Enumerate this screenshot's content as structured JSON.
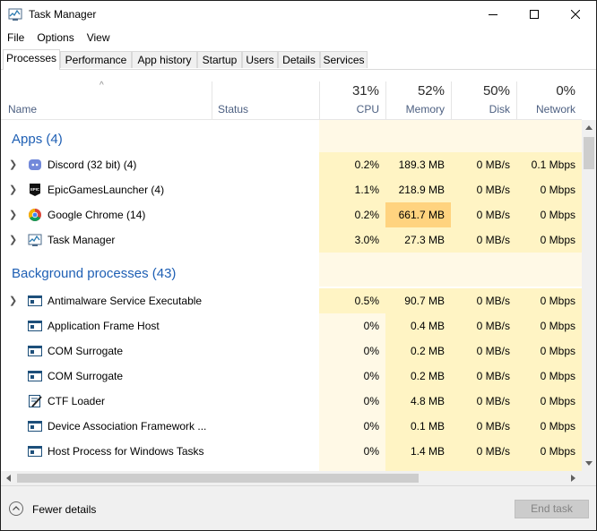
{
  "window": {
    "title": "Task Manager"
  },
  "menu": [
    "File",
    "Options",
    "View"
  ],
  "tabs": [
    "Processes",
    "Performance",
    "App history",
    "Startup",
    "Users",
    "Details",
    "Services"
  ],
  "columns": {
    "name": "Name",
    "status": "Status",
    "cpu": {
      "pct": "31%",
      "label": "CPU"
    },
    "memory": {
      "pct": "52%",
      "label": "Memory"
    },
    "disk": {
      "pct": "50%",
      "label": "Disk"
    },
    "network": {
      "pct": "0%",
      "label": "Network"
    }
  },
  "groups": [
    {
      "title": "Apps (4)"
    },
    {
      "title": "Background processes (43)"
    }
  ],
  "apps": [
    {
      "name": "Discord (32 bit) (4)",
      "icon": "discord-icon",
      "cpu": "0.2%",
      "memory": "189.3 MB",
      "disk": "0 MB/s",
      "network": "0.1 Mbps"
    },
    {
      "name": "EpicGamesLauncher (4)",
      "icon": "epic-games-icon",
      "cpu": "1.1%",
      "memory": "218.9 MB",
      "disk": "0 MB/s",
      "network": "0 Mbps"
    },
    {
      "name": "Google Chrome (14)",
      "icon": "chrome-icon",
      "cpu": "0.2%",
      "memory": "661.7 MB",
      "disk": "0 MB/s",
      "network": "0 Mbps"
    },
    {
      "name": "Task Manager",
      "icon": "task-manager-icon",
      "cpu": "3.0%",
      "memory": "27.3 MB",
      "disk": "0 MB/s",
      "network": "0 Mbps"
    }
  ],
  "background": [
    {
      "name": "Antimalware Service Executable",
      "icon": "service-window-icon",
      "cpu": "0.5%",
      "memory": "90.7 MB",
      "disk": "0 MB/s",
      "network": "0 Mbps"
    },
    {
      "name": "Application Frame Host",
      "icon": "service-window-icon",
      "cpu": "0%",
      "memory": "0.4 MB",
      "disk": "0 MB/s",
      "network": "0 Mbps"
    },
    {
      "name": "COM Surrogate",
      "icon": "service-window-icon",
      "cpu": "0%",
      "memory": "0.2 MB",
      "disk": "0 MB/s",
      "network": "0 Mbps"
    },
    {
      "name": "COM Surrogate",
      "icon": "service-window-icon",
      "cpu": "0%",
      "memory": "0.2 MB",
      "disk": "0 MB/s",
      "network": "0 Mbps"
    },
    {
      "name": "CTF Loader",
      "icon": "ctf-loader-icon",
      "cpu": "0%",
      "memory": "4.8 MB",
      "disk": "0 MB/s",
      "network": "0 Mbps"
    },
    {
      "name": "Device Association Framework ...",
      "icon": "service-window-icon",
      "cpu": "0%",
      "memory": "0.1 MB",
      "disk": "0 MB/s",
      "network": "0 Mbps"
    },
    {
      "name": "Host Process for Windows Tasks",
      "icon": "service-window-icon",
      "cpu": "0%",
      "memory": "1.4 MB",
      "disk": "0 MB/s",
      "network": "0 Mbps"
    }
  ],
  "footer": {
    "fewer_details": "Fewer details",
    "end_task": "End task"
  },
  "colors": {
    "group_title": "#1e5fb4",
    "heat_light": "#fff9e6",
    "heat_mid": "#fff4c4",
    "heat_high": "#ffd37f"
  }
}
